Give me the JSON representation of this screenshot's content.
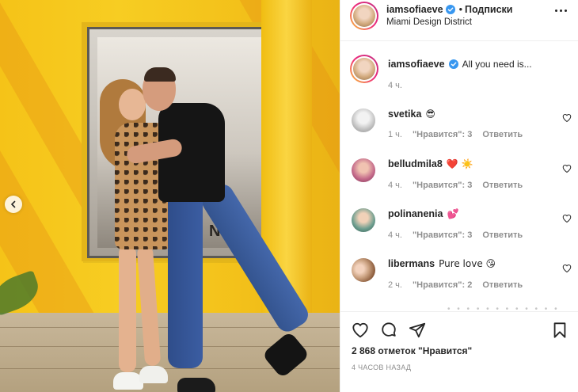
{
  "post": {
    "author": "iamsofiaeve",
    "follow_label": "Подписки",
    "location": "Miami Design District",
    "caption_text": "All you need is...",
    "caption_time": "4 ч.",
    "likes_label": "2 868 отметок \"Нравится\"",
    "time_ago": "4 часов назад",
    "photo_sign": "NDI"
  },
  "comments": [
    {
      "username": "svetika",
      "text": "😎",
      "time": "1 ч.",
      "likes": "\"Нравится\": 3",
      "reply": "Ответить",
      "avatar_color": "#d9d9d9"
    },
    {
      "username": "belludmila8",
      "text": "❤️ ☀️",
      "time": "4 ч.",
      "likes": "\"Нравится\": 3",
      "reply": "Ответить",
      "avatar_color": "#c46a8a"
    },
    {
      "username": "polinanenia",
      "text": "💕",
      "time": "4 ч.",
      "likes": "\"Нравится\": 3",
      "reply": "Ответить",
      "avatar_color": "#6e9e8f"
    },
    {
      "username": "libermans",
      "text": "Pure love 😘",
      "time": "2 ч.",
      "likes": "\"Нравится\": 2",
      "reply": "Ответить",
      "avatar_color": "#c9a07f"
    }
  ],
  "icons": {
    "verified": "verified-badge-icon",
    "more": "more-options-icon",
    "like": "heart-icon",
    "comment": "comment-icon",
    "share": "share-icon",
    "save": "bookmark-icon",
    "prev": "chevron-left-icon"
  },
  "colors": {
    "verified_blue": "#3897f0",
    "meta_gray": "#8e8e8e",
    "text": "#262626",
    "photo_wall": "#f2c617"
  }
}
